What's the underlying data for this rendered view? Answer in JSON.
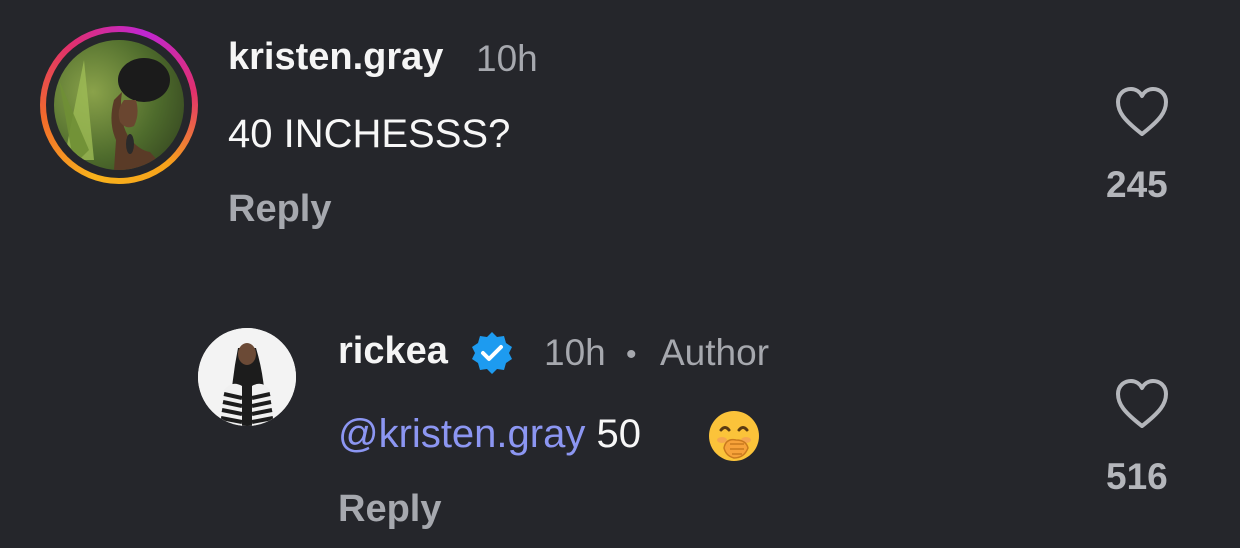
{
  "comments": [
    {
      "username": "kristen.gray",
      "time": "10h",
      "text": "40 INCHESSS?",
      "reply_label": "Reply",
      "likes": "245",
      "avatar_ring": "story-ring-gradient"
    },
    {
      "username": "rickea",
      "verified": true,
      "time": "10h",
      "separator": "•",
      "author_label": "Author",
      "mention": "@kristen.gray",
      "text": "50",
      "emoji": "hand-over-mouth-emoji",
      "reply_label": "Reply",
      "likes": "516"
    }
  ],
  "colors": {
    "background": "#25262b",
    "muted": "#a6a8ae",
    "mention": "#8c96f2",
    "verified": "#1d9bf0"
  }
}
